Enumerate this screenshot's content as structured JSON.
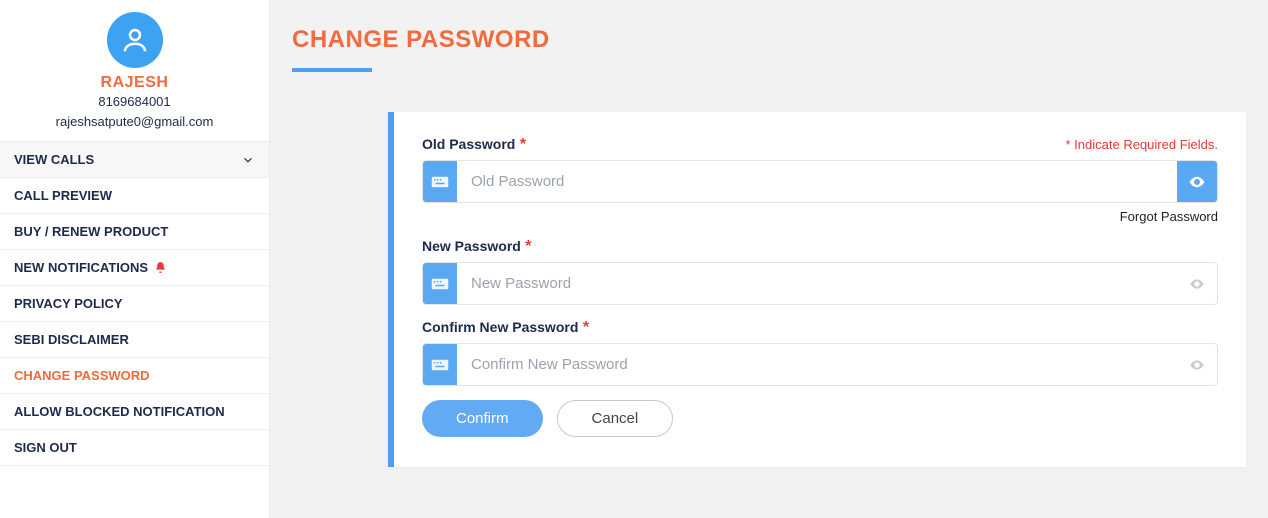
{
  "profile": {
    "name": "RAJESH",
    "phone": "8169684001",
    "email": "rajeshsatpute0@gmail.com"
  },
  "nav": {
    "view_calls": "VIEW CALLS",
    "call_preview": "CALL PREVIEW",
    "buy_renew": "BUY / RENEW PRODUCT",
    "new_notifications": "NEW NOTIFICATIONS",
    "privacy_policy": "PRIVACY POLICY",
    "sebi_disclaimer": "SEBI DISCLAIMER",
    "change_password": "CHANGE PASSWORD",
    "allow_blocked": "ALLOW BLOCKED NOTIFICATION",
    "sign_out": "SIGN OUT"
  },
  "page": {
    "title": "CHANGE PASSWORD",
    "required_note": "* Indicate Required Fields.",
    "labels": {
      "old_password": "Old Password",
      "new_password": "New Password",
      "confirm_password": "Confirm New Password"
    },
    "placeholders": {
      "old_password": "Old Password",
      "new_password": "New Password",
      "confirm_password": "Confirm New Password"
    },
    "forgot": "Forgot Password",
    "confirm_btn": "Confirm",
    "cancel_btn": "Cancel",
    "asterisk": "*"
  }
}
